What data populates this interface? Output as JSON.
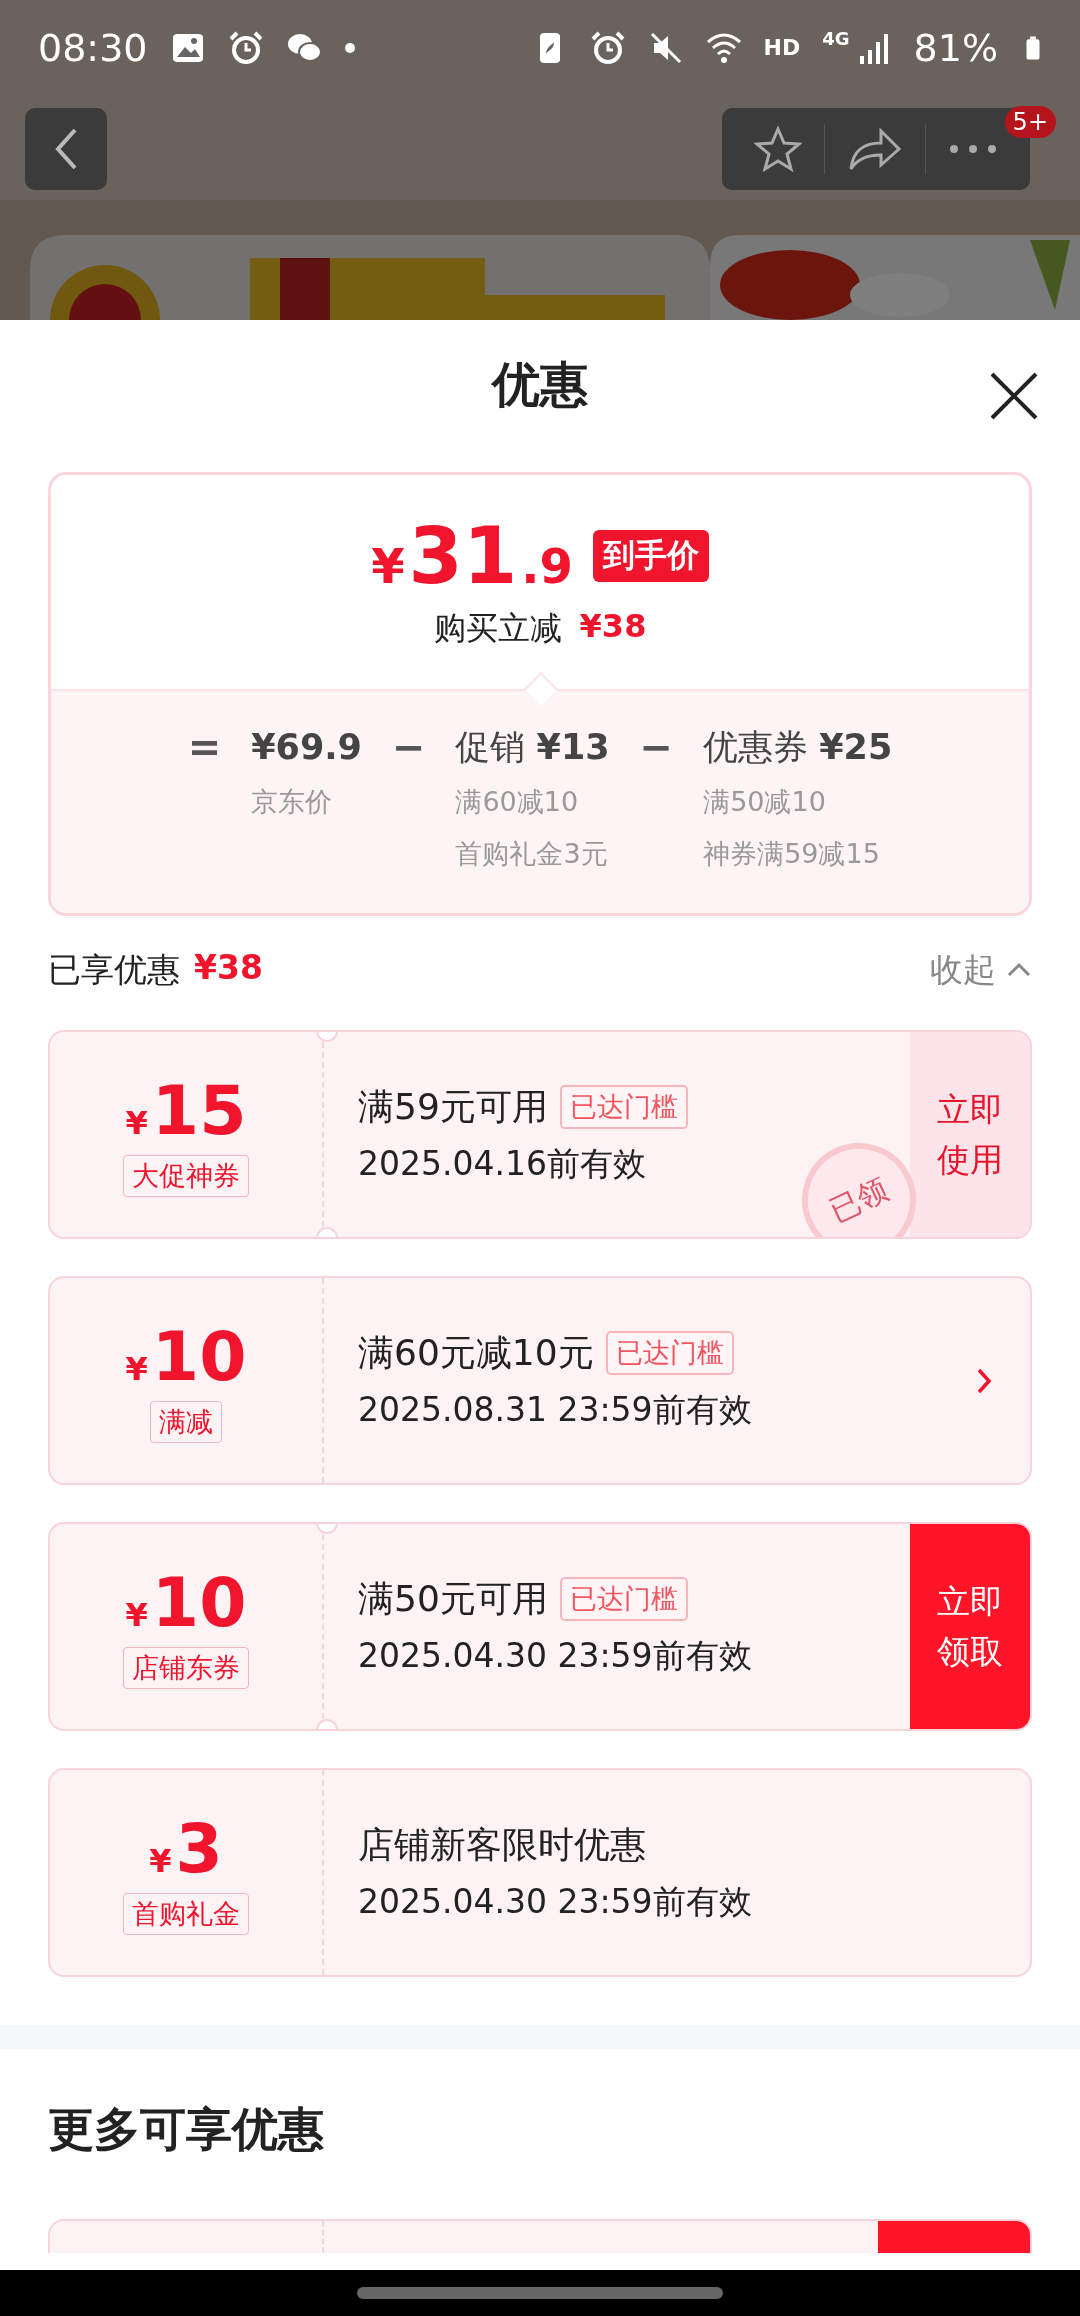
{
  "status_bar": {
    "time": "08:30",
    "network": "4G",
    "hd": "HD",
    "battery": "81%"
  },
  "top_bar": {
    "badge": "5+"
  },
  "sheet": {
    "title": "优惠",
    "price_card": {
      "currency": "¥",
      "integer": "31",
      "decimal": ".9",
      "tag": "到手价",
      "saving_label": "购买立减",
      "saving_amount": "¥38",
      "breakdown": [
        {
          "kind": "operator",
          "text": "="
        },
        {
          "kind": "term",
          "value": "¥69.9",
          "notes": [
            "京东价"
          ]
        },
        {
          "kind": "operator",
          "text": "−"
        },
        {
          "kind": "term",
          "label": "促销",
          "value": "¥13",
          "notes": [
            "满60减10",
            "首购礼金3元"
          ]
        },
        {
          "kind": "operator",
          "text": "−"
        },
        {
          "kind": "term",
          "label": "优惠券",
          "value": "¥25",
          "notes": [
            "满50减10",
            "神券满59减15"
          ]
        }
      ]
    },
    "enjoyed": {
      "label": "已享优惠",
      "amount": "¥38",
      "toggle": "收起"
    },
    "coupons": [
      {
        "currency": "¥",
        "amount": "15",
        "type": "大促神券",
        "condition": "满59元可用",
        "tag": "已达门槛",
        "validity": "2025.04.16前有效",
        "stamp": "已领",
        "kind": "use",
        "action_label": "立即使用"
      },
      {
        "currency": "¥",
        "amount": "10",
        "type": "满减",
        "condition": "满60元减10元",
        "tag": "已达门槛",
        "validity": "2025.08.31 23:59前有效",
        "kind": "arrow"
      },
      {
        "currency": "¥",
        "amount": "10",
        "type": "店铺东券",
        "condition": "满50元可用",
        "tag": "已达门槛",
        "validity": "2025.04.30 23:59前有效",
        "kind": "claim",
        "action_label": "立即领取"
      },
      {
        "currency": "¥",
        "amount": "3",
        "type": "首购礼金",
        "condition": "店铺新客限时优惠",
        "validity": "2025.04.30 23:59前有效",
        "kind": "none"
      }
    ],
    "more": {
      "title": "更多可享优惠",
      "coupons": [
        {
          "kind": "claim"
        }
      ]
    }
  }
}
